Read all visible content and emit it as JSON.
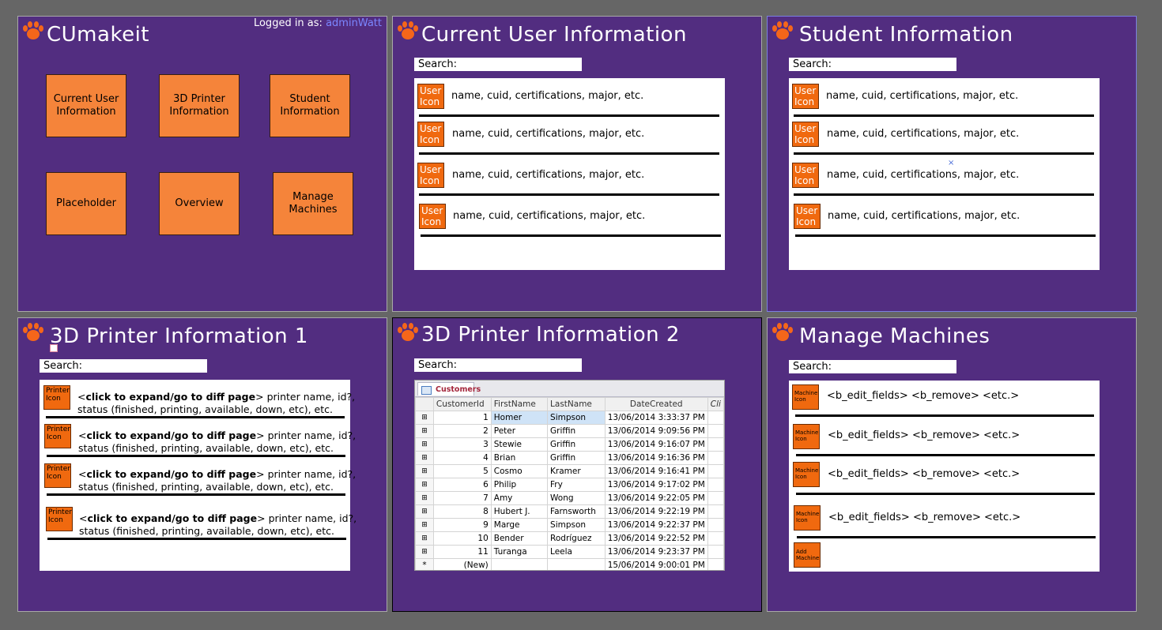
{
  "home": {
    "title": "CUmakeit",
    "login_prefix": "Logged in as:",
    "login_user": "adminWatt",
    "tiles": [
      "Current User Information",
      "3D Printer Information",
      "Student Information",
      "Placeholder",
      "Overview",
      "Manage Machines"
    ]
  },
  "current_user": {
    "title": "Current User Information",
    "search_label": "Search:",
    "rows": [
      {
        "icon": "User Icon",
        "text": "name, cuid, certifications, major, etc."
      },
      {
        "icon": "User Icon",
        "text": "name, cuid, certifications, major, etc."
      },
      {
        "icon": "User Icon",
        "text": "name, cuid, certifications, major, etc."
      },
      {
        "icon": "User Icon",
        "text": "name, cuid, certifications, major, etc."
      }
    ]
  },
  "student": {
    "title": "Student Information",
    "search_label": "Search:",
    "rows": [
      {
        "icon": "User Icon",
        "text": "name, cuid, certifications, major, etc."
      },
      {
        "icon": "User Icon",
        "text": "name, cuid, certifications, major, etc."
      },
      {
        "icon": "User Icon",
        "text": "name, cuid, certifications, major, etc."
      },
      {
        "icon": "User Icon",
        "text": "name, cuid, certifications, major, etc."
      }
    ]
  },
  "printer1": {
    "title": "3D Printer Information 1",
    "search_label": "Search:",
    "rows": [
      {
        "icon": "Printer Icon",
        "bold": "click to expand/go to diff page",
        "line1": "printer name, id?,",
        "line2": "status (finished, printing, available, down, etc), etc."
      },
      {
        "icon": "Printer Icon",
        "bold": "click to expand/go to diff page",
        "line1": "printer name, id?,",
        "line2": "status (finished, printing, available, down, etc), etc."
      },
      {
        "icon": "Printer Icon",
        "bold": "click to expand/go to diff page",
        "line1": "printer name, id?,",
        "line2": "status (finished, printing, available, down, etc), etc."
      },
      {
        "icon": "Printer Icon",
        "bold": "click to expand/go to diff page",
        "line1": "printer name, id?,",
        "line2": "status (finished, printing, available, down, etc), etc."
      }
    ]
  },
  "printer2": {
    "title": "3D Printer Information 2",
    "search_label": "Search:",
    "table": {
      "tab": "Customers",
      "columns": [
        "CustomerId",
        "FirstName",
        "LastName",
        "DateCreated",
        "Cli"
      ],
      "rows": [
        [
          "1",
          "Homer",
          "Simpson",
          "13/06/2014 3:33:37 PM"
        ],
        [
          "2",
          "Peter",
          "Griffin",
          "13/06/2014 9:09:56 PM"
        ],
        [
          "3",
          "Stewie",
          "Griffin",
          "13/06/2014 9:16:07 PM"
        ],
        [
          "4",
          "Brian",
          "Griffin",
          "13/06/2014 9:16:36 PM"
        ],
        [
          "5",
          "Cosmo",
          "Kramer",
          "13/06/2014 9:16:41 PM"
        ],
        [
          "6",
          "Philip",
          "Fry",
          "13/06/2014 9:17:02 PM"
        ],
        [
          "7",
          "Amy",
          "Wong",
          "13/06/2014 9:22:05 PM"
        ],
        [
          "8",
          "Hubert J.",
          "Farnsworth",
          "13/06/2014 9:22:19 PM"
        ],
        [
          "9",
          "Marge",
          "Simpson",
          "13/06/2014 9:22:37 PM"
        ],
        [
          "10",
          "Bender",
          "Rodríguez",
          "13/06/2014 9:22:52 PM"
        ],
        [
          "11",
          "Turanga",
          "Leela",
          "13/06/2014 9:23:37 PM"
        ]
      ],
      "new_row": [
        "(New)",
        "15/06/2014 9:00:01 PM"
      ]
    }
  },
  "machines": {
    "title": "Manage Machines",
    "search_label": "Search:",
    "rows": [
      {
        "icon": "Machine Icon",
        "text": "<b_edit_fields> <b_remove> <etc.>"
      },
      {
        "icon": "Machine Icon",
        "text": "<b_edit_fields> <b_remove> <etc.>"
      },
      {
        "icon": "Machine Icon",
        "text": "<b_edit_fields> <b_remove> <etc.>"
      },
      {
        "icon": "Machine Icon",
        "text": "<b_edit_fields> <b_remove> <etc.>"
      }
    ],
    "add_label": "Add Machine"
  }
}
